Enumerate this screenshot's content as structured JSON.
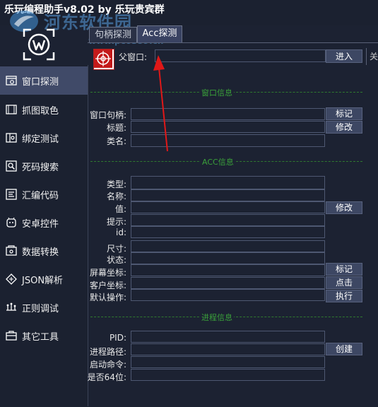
{
  "app": {
    "title": "乐玩编程助手v8.02   by 乐玩贵宾群",
    "watermark": "河东软件园",
    "watermark_url": "www.pc0359.cn"
  },
  "sidebar": {
    "items": [
      {
        "label": "窗口探测",
        "icon": "window-probe-icon"
      },
      {
        "label": "抓图取色",
        "icon": "screenshot-icon"
      },
      {
        "label": "绑定测试",
        "icon": "bind-test-icon"
      },
      {
        "label": "死码搜索",
        "icon": "search-icon"
      },
      {
        "label": "汇编代码",
        "icon": "assembly-icon"
      },
      {
        "label": "安卓控件",
        "icon": "android-icon"
      },
      {
        "label": "数据转换",
        "icon": "convert-icon"
      },
      {
        "label": "JSON解析",
        "icon": "json-icon"
      },
      {
        "label": "正则调试",
        "icon": "regex-icon"
      },
      {
        "label": "其它工具",
        "icon": "toolbox-icon"
      }
    ]
  },
  "tabs": [
    "句柄探测",
    "Acc探测"
  ],
  "acc_probe": {
    "parent_window_label": "父窗口:",
    "parent_window_value": "",
    "enter_button": "进入",
    "right_stub_text": "关",
    "window_info": {
      "header": "窗口信息",
      "handle_label": "窗口句柄:",
      "title_label": "标题:",
      "class_label": "类名:",
      "mark_button": "标记",
      "modify_button": "修改"
    },
    "acc_info": {
      "header": "ACC信息",
      "type_label": "类型:",
      "name_label": "名称:",
      "value_label": "值:",
      "hint_label": "提示:",
      "id_label": "id:",
      "size_label": "尺寸:",
      "state_label": "状态:",
      "screen_coord_label": "屏幕坐标:",
      "client_coord_label": "客户坐标:",
      "default_action_label": "默认操作:",
      "modify_button": "修改",
      "mark_button": "标记",
      "click_button": "点击",
      "execute_button": "执行"
    },
    "process_info": {
      "header": "进程信息",
      "pid_label": "PID:",
      "path_label": "进程路径:",
      "cmdline_label": "启动命令:",
      "is64_label": "是否64位:",
      "create_button": "创建"
    }
  },
  "colors": {
    "background": "#1c2232",
    "active_nav": "#404a68",
    "button": "#3d4763",
    "separator_green": "#3aa03a",
    "arrow_red": "#e01818"
  }
}
